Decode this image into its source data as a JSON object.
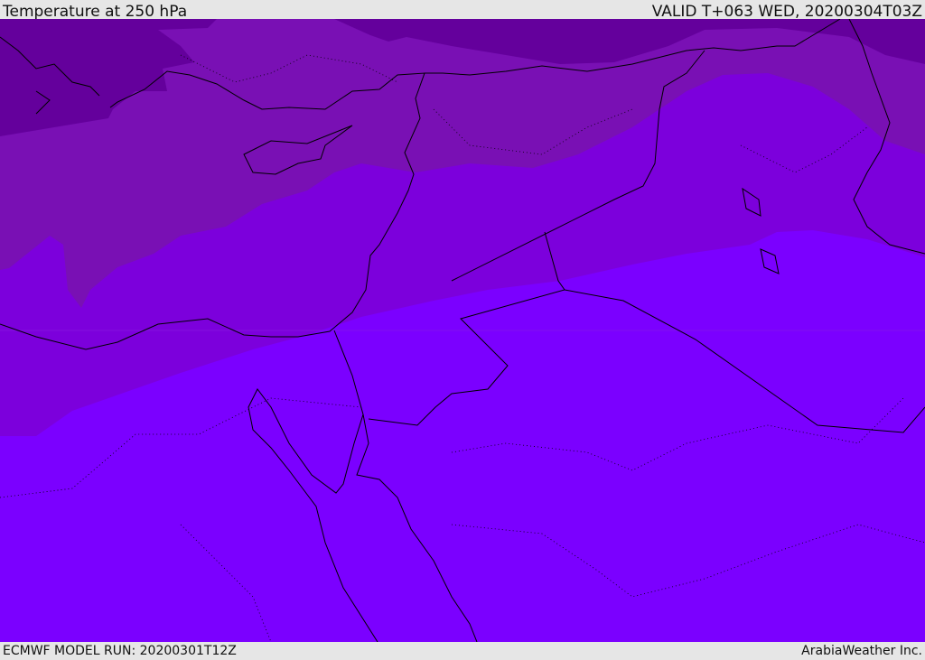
{
  "header": {
    "title": "Temperature at 250 hPa",
    "valid": "VALID T+063 WED, 20200304T03Z"
  },
  "footer": {
    "model_run": "ECMWF MODEL RUN: 20200301T12Z",
    "credit": "ArabiaWeather Inc."
  },
  "colors": {
    "band_coldest": "#64009c",
    "band_cold": "#7910b4",
    "band_mid": "#7c00dc",
    "band_warm": "#7b00ff",
    "coast": "#000000"
  }
}
